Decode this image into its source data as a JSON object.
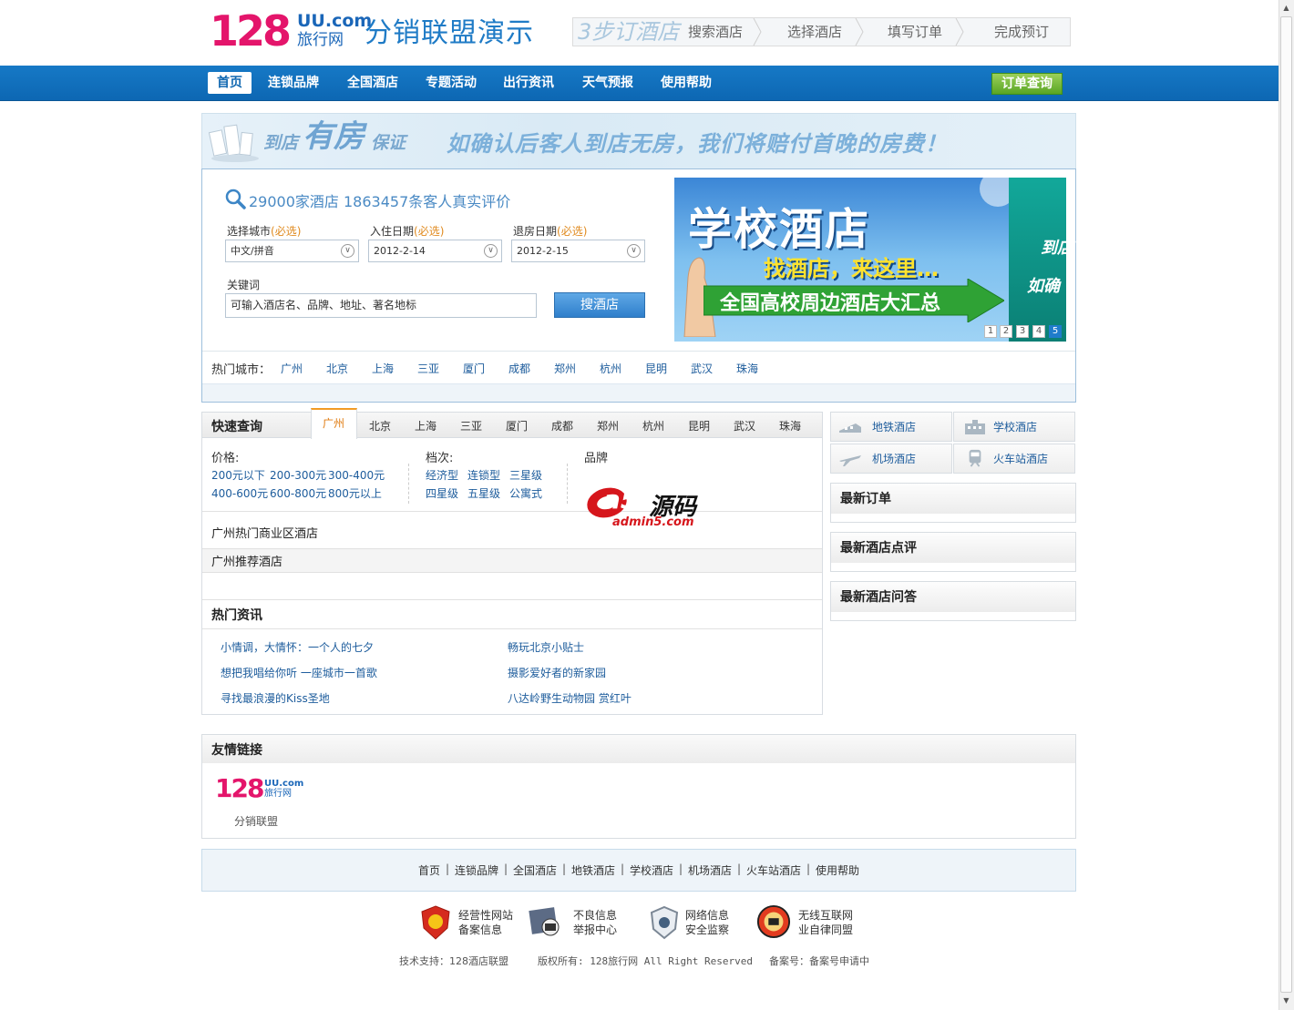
{
  "header": {
    "logo_number": "128",
    "logo_domain": "UU.com",
    "logo_cn": "旅行网",
    "site_title": "分销联盟演示",
    "steps_title": "3步订酒店",
    "steps": [
      "搜索酒店",
      "选择酒店",
      "填写订单",
      "完成预订"
    ]
  },
  "nav": {
    "items": [
      "首页",
      "连锁品牌",
      "全国酒店",
      "专题活动",
      "出行资讯",
      "天气预报",
      "使用帮助"
    ],
    "active": "首页",
    "order_query": "订单查询"
  },
  "guarantee": {
    "title_a": "到店",
    "title_b": "有房",
    "title_c": "保证",
    "text": "如确认后客人到店无房，我们将赔付首晚的房费！"
  },
  "search": {
    "stats": "29000家酒店  1863457条客人真实评价",
    "city_label": "选择城市",
    "checkin_label": "入住日期",
    "checkout_label": "退房日期",
    "required": "(必选)",
    "city_value": "中文/拼音",
    "checkin_value": "2012-2-14",
    "checkout_value": "2012-2-15",
    "keyword_label": "关键词",
    "keyword_placeholder": "可输入酒店名、品牌、地址、著名地标",
    "button": "搜酒店",
    "hot_label": "热门城市：",
    "hot_cities": [
      "广州",
      "北京",
      "上海",
      "三亚",
      "厦门",
      "成都",
      "郑州",
      "杭州",
      "昆明",
      "武汉",
      "珠海"
    ]
  },
  "banner": {
    "title": "学校酒店",
    "subtitle": "找酒店，来这里…",
    "arrow_text": "全国高校周边酒店大汇总",
    "right_1": "到店",
    "right_2": "如确",
    "dots": [
      "1",
      "2",
      "3",
      "4",
      "5"
    ],
    "active_dot": "5"
  },
  "quick": {
    "title": "快速查询",
    "tabs": [
      "广州",
      "北京",
      "上海",
      "三亚",
      "厦门",
      "成都",
      "郑州",
      "杭州",
      "昆明",
      "武汉",
      "珠海"
    ],
    "active_tab": "广州",
    "price_label": "价格:",
    "prices": [
      "200元以下",
      "200-300元",
      "300-400元",
      "400-600元",
      "600-800元",
      "800元以上"
    ],
    "grade_label": "档次:",
    "grades": [
      "经济型",
      "连锁型",
      "三星级",
      "四星级",
      "五星级",
      "公寓式"
    ],
    "brand_label": "品牌",
    "watermark_a5": "a5",
    "watermark_cn": "源码",
    "watermark_url": "admin5.com",
    "biz_title": "广州热门商业区酒店",
    "rec_title": "广州推荐酒店",
    "news_title": "热门资讯",
    "news": [
      "小情调，大情怀：一个人的七夕",
      "畅玩北京小贴士",
      "想把我唱给你听  一座城市一首歌",
      "摄影爱好者的新家园",
      "寻找最浪漫的Kiss圣地",
      "八达岭野生动物园 赏红叶"
    ]
  },
  "right": {
    "types": [
      "地铁酒店",
      "学校酒店",
      "机场酒店",
      "火车站酒店"
    ],
    "boxes": [
      "最新订单",
      "最新酒店点评",
      "最新酒店问答"
    ]
  },
  "friends": {
    "title": "友情链接",
    "logo_number": "128",
    "logo_domain": "UU.com",
    "logo_cn": "旅行网",
    "caption": "分销联盟"
  },
  "footer": {
    "links": [
      "首页",
      "连锁品牌",
      "全国酒店",
      "地铁酒店",
      "学校酒店",
      "机场酒店",
      "火车站酒店",
      "使用帮助"
    ],
    "badges": [
      {
        "line1": "经营性网站",
        "line2": "备案信息"
      },
      {
        "line1": "不良信息",
        "line2": "举报中心"
      },
      {
        "line1": "网络信息",
        "line2": "安全监察"
      },
      {
        "line1": "无线互联网",
        "line2": "业自律同盟"
      }
    ],
    "tech": "技术支持：128酒店联盟",
    "copyright": "版权所有: 128旅行网 All Right Reserved",
    "icp": "备案号：备案号申请中"
  },
  "colors": {
    "brand_pink": "#e4156b",
    "brand_blue": "#1a66b8",
    "nav_blue": "#0d67b3",
    "order_green": "#5aa524",
    "link_blue": "#1d5c9c",
    "tab_orange": "#f29b24"
  }
}
